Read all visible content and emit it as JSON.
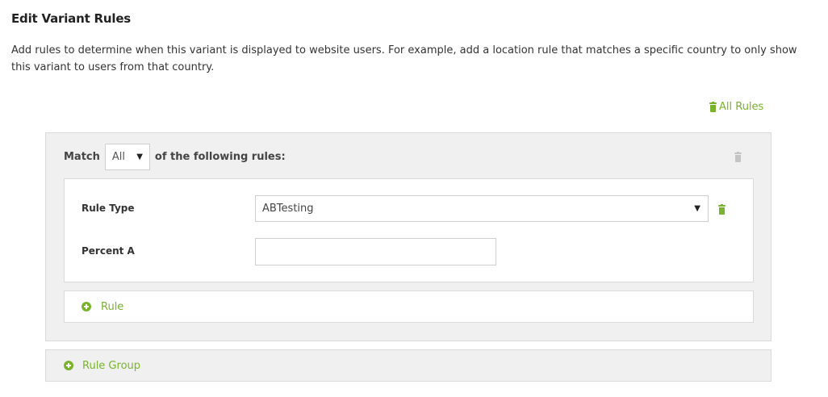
{
  "page": {
    "title": "Edit Variant Rules",
    "description": "Add rules to determine when this variant is displayed to website users. For example, add a location rule that matches a specific country to only show this variant to users from that country."
  },
  "all_rules_link": {
    "label": "All Rules",
    "icon": "trash-icon"
  },
  "rule_group": {
    "match_prefix": "Match",
    "match_value": "All",
    "match_suffix": "of the following rules:",
    "rule": {
      "type_label": "Rule Type",
      "type_value": "ABTesting",
      "percent_label": "Percent A",
      "percent_value": "",
      "percent_placeholder": ""
    },
    "add_rule_label": "Rule"
  },
  "add_rule_group_label": "Rule Group",
  "colors": {
    "accent": "#7ab32e",
    "panel_bg": "#f0f0f0",
    "border": "#dadada",
    "disabled_icon": "#c4c4c4"
  }
}
